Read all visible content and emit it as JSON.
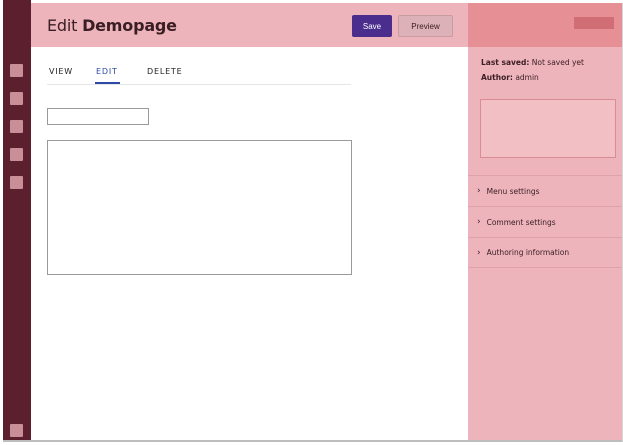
{
  "header": {
    "title_prefix": "Edit",
    "title_name": "Demopage",
    "save_label": "Save",
    "preview_label": "Preview"
  },
  "tabs": [
    {
      "label": "VIEW",
      "active": false
    },
    {
      "label": "EDIT",
      "active": true
    },
    {
      "label": "DELETE",
      "active": false
    }
  ],
  "form": {
    "title_value": "",
    "body_value": ""
  },
  "sidebar": {
    "last_saved_label": "Last saved:",
    "last_saved_value": "Not saved yet",
    "author_label": "Author:",
    "author_value": "admin",
    "sections": [
      {
        "label": "Menu settings",
        "icon": "chevron-right-icon"
      },
      {
        "label": "Comment settings",
        "icon": "chevron-right-icon"
      },
      {
        "label": "Authoring information",
        "icon": "chevron-right-icon"
      }
    ]
  },
  "colors": {
    "toolbar": "#5c1f2e",
    "header": "#edb4bb",
    "sidebar_header": "#e68f95",
    "save_button": "#4a2d8c",
    "active_tab": "#2d4aa6"
  }
}
